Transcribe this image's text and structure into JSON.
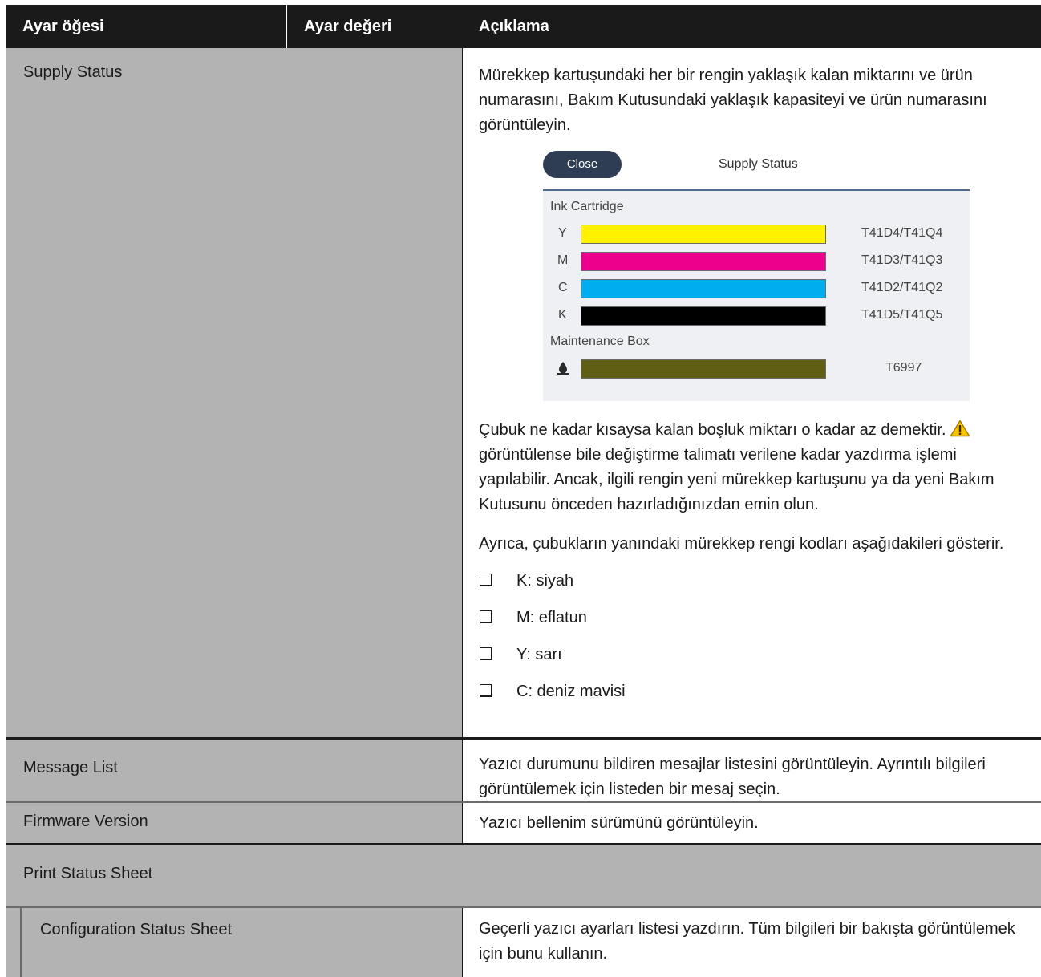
{
  "header": {
    "col1": "Ayar öğesi",
    "col2": "Ayar değeri",
    "col3": "Açıklama"
  },
  "supply_status": {
    "label": "Supply Status",
    "intro": "Mürekkep kartuşundaki her bir rengin yaklaşık kalan miktarını ve ürün numarasını, Bakım Kutusundaki yaklaşık kapasiteyi ve ürün numarasını görüntüleyin.",
    "panel": {
      "close_label": "Close",
      "title": "Supply Status",
      "ink_heading": "Ink Cartridge",
      "inks": [
        {
          "letter": "Y",
          "code": "T41D4/T41Q4",
          "color": "#fff100"
        },
        {
          "letter": "M",
          "code": "T41D3/T41Q3",
          "color": "#ec008c"
        },
        {
          "letter": "C",
          "code": "T41D2/T41Q2",
          "color": "#00aeef"
        },
        {
          "letter": "K",
          "code": "T41D5/T41Q5",
          "color": "#000000"
        }
      ],
      "maintenance_heading": "Maintenance Box",
      "maintenance_code": "T6997",
      "maintenance_color": "#5f5e14"
    },
    "para1_before_icon": "Çubuk ne kadar kısaysa kalan boşluk miktarı o kadar az demektir.",
    "para1_after_icon": "görüntülense bile değiştirme talimatı verilene kadar yazdırma işlemi yapılabilir. Ancak, ilgili rengin yeni mürekkep kartuşunu ya da yeni Bakım Kutusunu önceden hazırladığınızdan emin olun.",
    "para2": "Ayrıca, çubukların yanındaki mürekkep rengi kodları aşağıdakileri gösterir.",
    "list": [
      "K: siyah",
      "M: eflatun",
      "Y: sarı",
      "C: deniz mavisi"
    ]
  },
  "message_list": {
    "label": "Message List",
    "desc": "Yazıcı durumunu bildiren mesajlar listesini görüntüleyin. Ayrıntılı bilgileri görüntülemek için listeden bir mesaj seçin."
  },
  "firmware_version": {
    "label": "Firmware Version",
    "desc": "Yazıcı bellenim sürümünü görüntüleyin."
  },
  "print_status_sheet": {
    "label": "Print Status Sheet"
  },
  "configuration_status_sheet": {
    "label": "Configuration Status Sheet",
    "desc": "Geçerli yazıcı ayarları listesi yazdırın. Tüm bilgileri bir bakışta görüntülemek için bunu kullanın."
  }
}
